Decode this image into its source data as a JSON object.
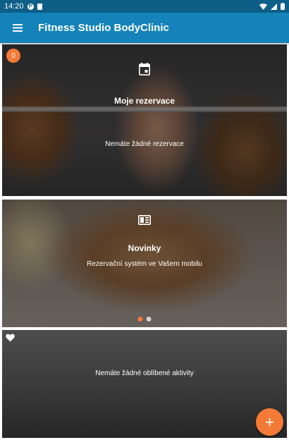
{
  "status_bar": {
    "time": "14:20",
    "notification_icons": [
      "p-icon",
      "sim-card-icon"
    ],
    "system_icons": [
      "wifi-icon",
      "signal-icon",
      "battery-icon"
    ]
  },
  "app_bar": {
    "title": "Fitness Studio BodyClinic",
    "menu_icon": "hamburger-menu-icon"
  },
  "reservations_card": {
    "badge_count": "0",
    "icon": "calendar-icon",
    "title": "Moje rezervace",
    "text": "Nemáte žádné rezervace"
  },
  "news_card": {
    "icon": "newspaper-icon",
    "title": "Novinky",
    "text": "Rezervační systém ve Vašem mobilu",
    "pager": {
      "page_count": 2,
      "active_index": 0
    }
  },
  "favorites_card": {
    "icon": "heart-icon",
    "text": "Nemáte žádné oblíbené aktivity"
  },
  "fab": {
    "label": "+",
    "icon": "plus-icon"
  },
  "colors": {
    "status_bar": "#0d5f88",
    "app_bar": "#1483b9",
    "accent": "#f47a37"
  }
}
